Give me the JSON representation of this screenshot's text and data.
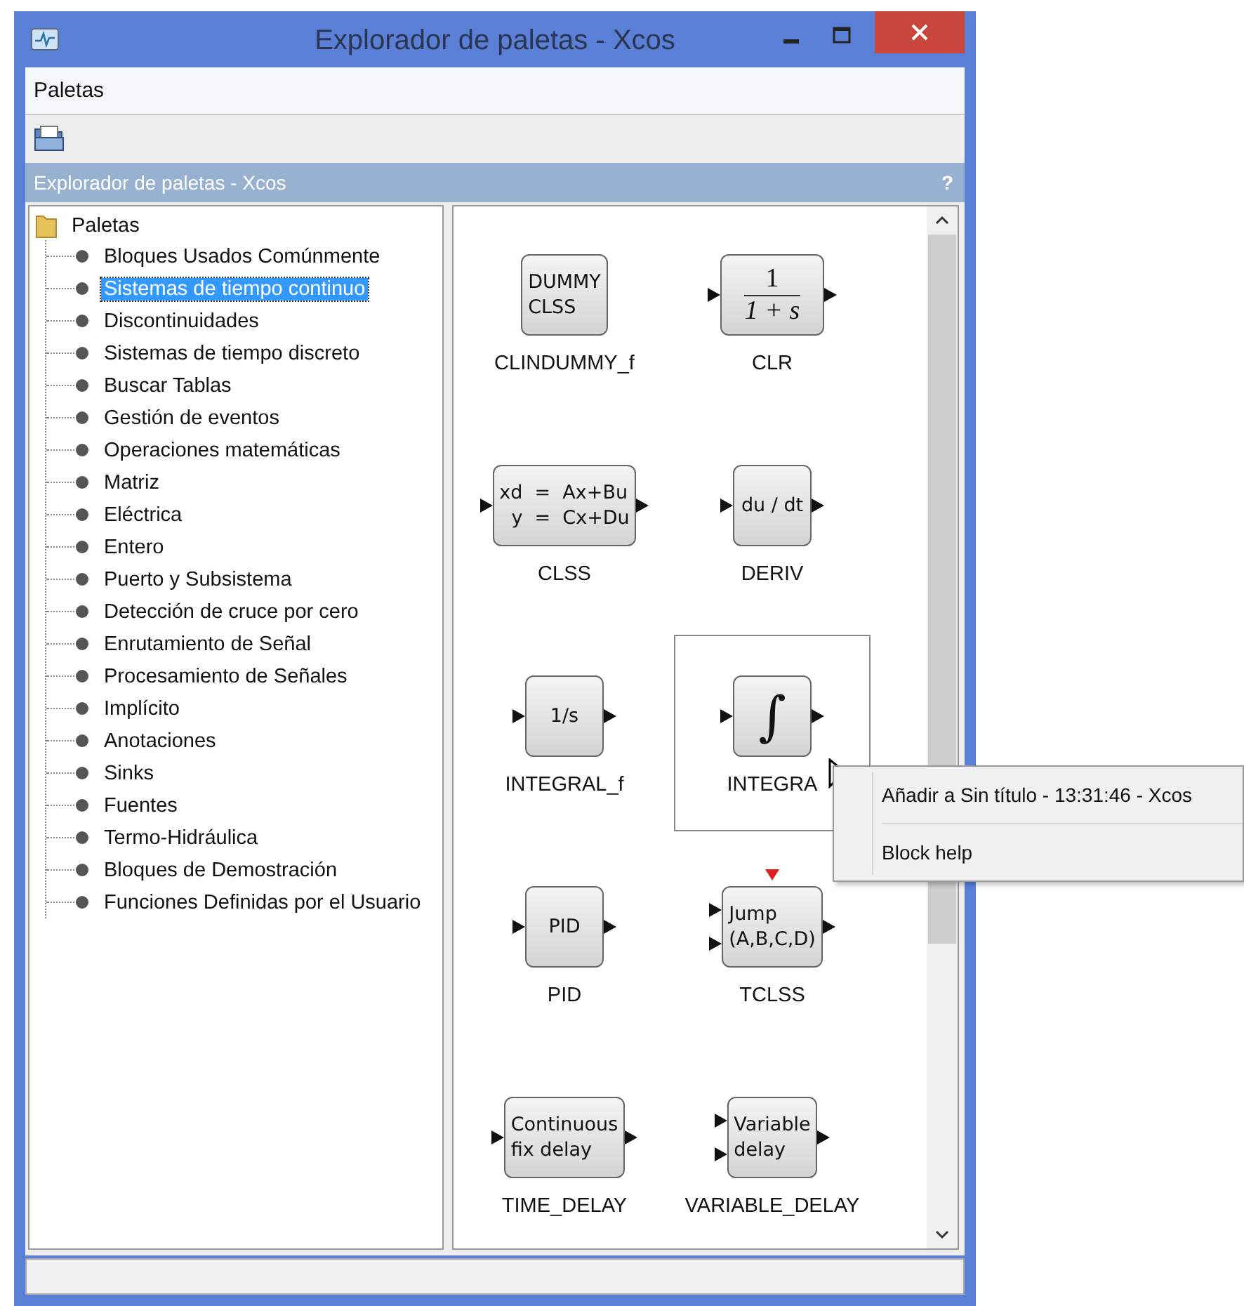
{
  "window": {
    "title": "Explorador de paletas - Xcos"
  },
  "menu": [
    "Paletas"
  ],
  "panel": {
    "title": "Explorador de paletas - Xcos",
    "help": "?"
  },
  "tree": {
    "label": "Paletas",
    "children": [
      {
        "label": "Bloques Usados Comúnmente",
        "selected": false
      },
      {
        "label": "Sistemas de tiempo continuo",
        "selected": true
      },
      {
        "label": "Discontinuidades",
        "selected": false
      },
      {
        "label": "Sistemas de tiempo discreto",
        "selected": false
      },
      {
        "label": "Buscar Tablas",
        "selected": false
      },
      {
        "label": "Gestión de eventos",
        "selected": false
      },
      {
        "label": "Operaciones matemáticas",
        "selected": false
      },
      {
        "label": "Matriz",
        "selected": false
      },
      {
        "label": "Eléctrica",
        "selected": false
      },
      {
        "label": "Entero",
        "selected": false
      },
      {
        "label": "Puerto y Subsistema",
        "selected": false
      },
      {
        "label": "Detección de cruce por cero",
        "selected": false
      },
      {
        "label": "Enrutamiento de Señal",
        "selected": false
      },
      {
        "label": "Procesamiento de Señales",
        "selected": false
      },
      {
        "label": "Implícito",
        "selected": false
      },
      {
        "label": "Anotaciones",
        "selected": false
      },
      {
        "label": "Sinks",
        "selected": false
      },
      {
        "label": "Fuentes",
        "selected": false
      },
      {
        "label": "Termo-Hidráulica",
        "selected": false
      },
      {
        "label": "Bloques de Demostración",
        "selected": false
      },
      {
        "label": "Funciones Definidas por el Usuario",
        "selected": false
      }
    ]
  },
  "blocks": [
    {
      "kind": "text",
      "lines": [
        "DUMMY",
        "CLSS"
      ],
      "label": "CLINDUMMY_f",
      "selected": false
    },
    {
      "kind": "fraction",
      "numerator": "1",
      "denominator": "1 + s",
      "ports": [
        {
          "kind": "input"
        },
        {
          "kind": "output"
        }
      ],
      "label": "CLR",
      "selected": false
    },
    {
      "kind": "text",
      "lines": [
        "xd  =  Ax+Bu",
        "  y  =  Cx+Du"
      ],
      "ports": [
        {
          "kind": "input"
        },
        {
          "kind": "output"
        }
      ],
      "label": "CLSS",
      "selected": false
    },
    {
      "kind": "text",
      "lines": [
        "du / dt"
      ],
      "ports": [
        {
          "kind": "input"
        },
        {
          "kind": "output"
        }
      ],
      "label": "DERIV",
      "selected": false
    },
    {
      "kind": "text",
      "lines": [
        "1/s"
      ],
      "ports": [
        {
          "kind": "input"
        },
        {
          "kind": "output"
        }
      ],
      "label": "INTEGRAL_f",
      "selected": false
    },
    {
      "kind": "symbol",
      "symbol": "∫",
      "ports": [
        {
          "kind": "input"
        },
        {
          "kind": "output"
        }
      ],
      "label": "INTEGRA",
      "selected": true
    },
    {
      "kind": "text",
      "lines": [
        "PID"
      ],
      "ports": [
        {
          "kind": "input"
        },
        {
          "kind": "output"
        }
      ],
      "label": "PID",
      "selected": false
    },
    {
      "kind": "text",
      "lines": [
        "Jump",
        "(A,B,C,D)"
      ],
      "ports": [
        {
          "kind": "input"
        },
        {
          "kind": "input"
        },
        {
          "kind": "output"
        },
        {
          "kind": "event"
        }
      ],
      "label": "TCLSS",
      "selected": false
    },
    {
      "kind": "text",
      "lines": [
        "Continuous",
        "fix delay"
      ],
      "ports": [
        {
          "kind": "input"
        },
        {
          "kind": "output"
        }
      ],
      "label": "TIME_DELAY",
      "selected": false
    },
    {
      "kind": "text",
      "lines": [
        "Variable",
        "delay"
      ],
      "ports": [
        {
          "kind": "input"
        },
        {
          "kind": "input"
        },
        {
          "kind": "output"
        }
      ],
      "label": "VARIABLE_DELAY",
      "selected": false
    }
  ],
  "context_menu": [
    "Añadir a Sin título - 13:31:46 - Xcos",
    "Block help"
  ]
}
